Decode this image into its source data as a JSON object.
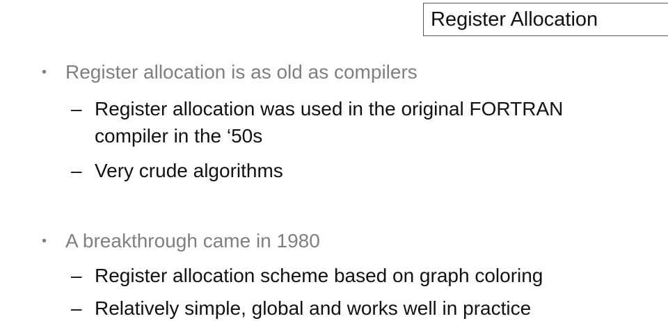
{
  "watermark": "",
  "slide": {
    "title": "Register Allocation",
    "bullet_marker": "•",
    "dash_marker": "–",
    "blocks": [
      {
        "text": "Register allocation is as old as compilers",
        "subs": [
          {
            "lines": [
              "Register allocation was used in the original FORTRAN",
              "compiler in the ‘50s"
            ]
          },
          {
            "lines": [
              "Very crude algorithms"
            ]
          }
        ]
      },
      {
        "text": "A breakthrough came in 1980",
        "subs": [
          {
            "lines": [
              "Register allocation scheme based on graph coloring"
            ]
          },
          {
            "lines": [
              "Relatively simple, global and works well in practice"
            ]
          }
        ]
      }
    ]
  }
}
